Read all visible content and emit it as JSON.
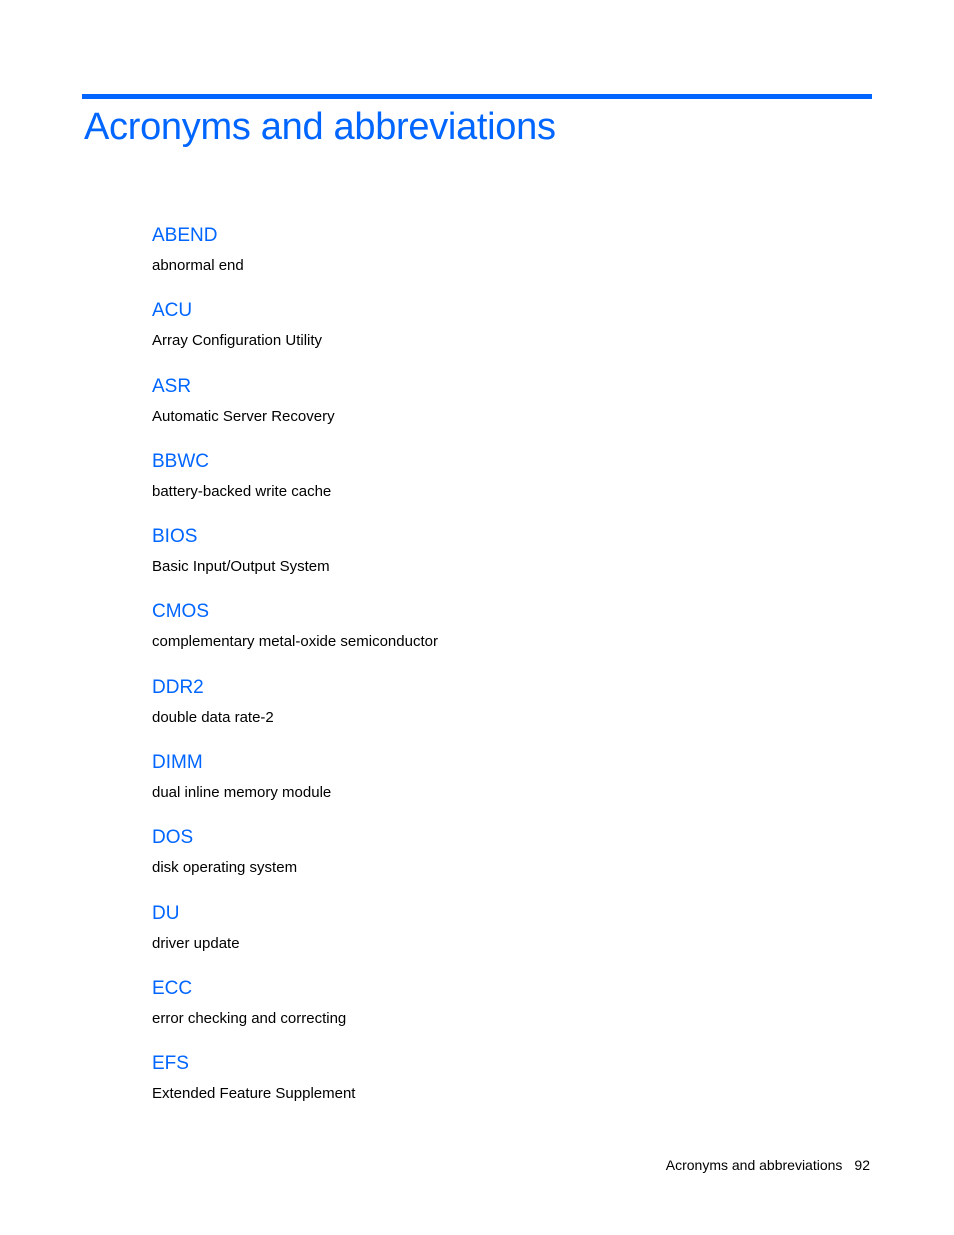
{
  "page": {
    "title": "Acronyms and abbreviations",
    "entries": [
      {
        "term": "ABEND",
        "definition": "abnormal end"
      },
      {
        "term": "ACU",
        "definition": "Array Configuration Utility"
      },
      {
        "term": "ASR",
        "definition": "Automatic Server Recovery"
      },
      {
        "term": "BBWC",
        "definition": "battery-backed write cache"
      },
      {
        "term": "BIOS",
        "definition": "Basic Input/Output System"
      },
      {
        "term": "CMOS",
        "definition": "complementary metal-oxide semiconductor"
      },
      {
        "term": "DDR2",
        "definition": "double data rate-2"
      },
      {
        "term": "DIMM",
        "definition": "dual inline memory module"
      },
      {
        "term": "DOS",
        "definition": "disk operating system"
      },
      {
        "term": "DU",
        "definition": "driver update"
      },
      {
        "term": "ECC",
        "definition": "error checking and correcting"
      },
      {
        "term": "EFS",
        "definition": "Extended Feature Supplement"
      }
    ],
    "footer": {
      "section": "Acronyms and abbreviations",
      "page_number": "92"
    }
  },
  "colors": {
    "accent": "#0066ff",
    "text": "#000000"
  }
}
